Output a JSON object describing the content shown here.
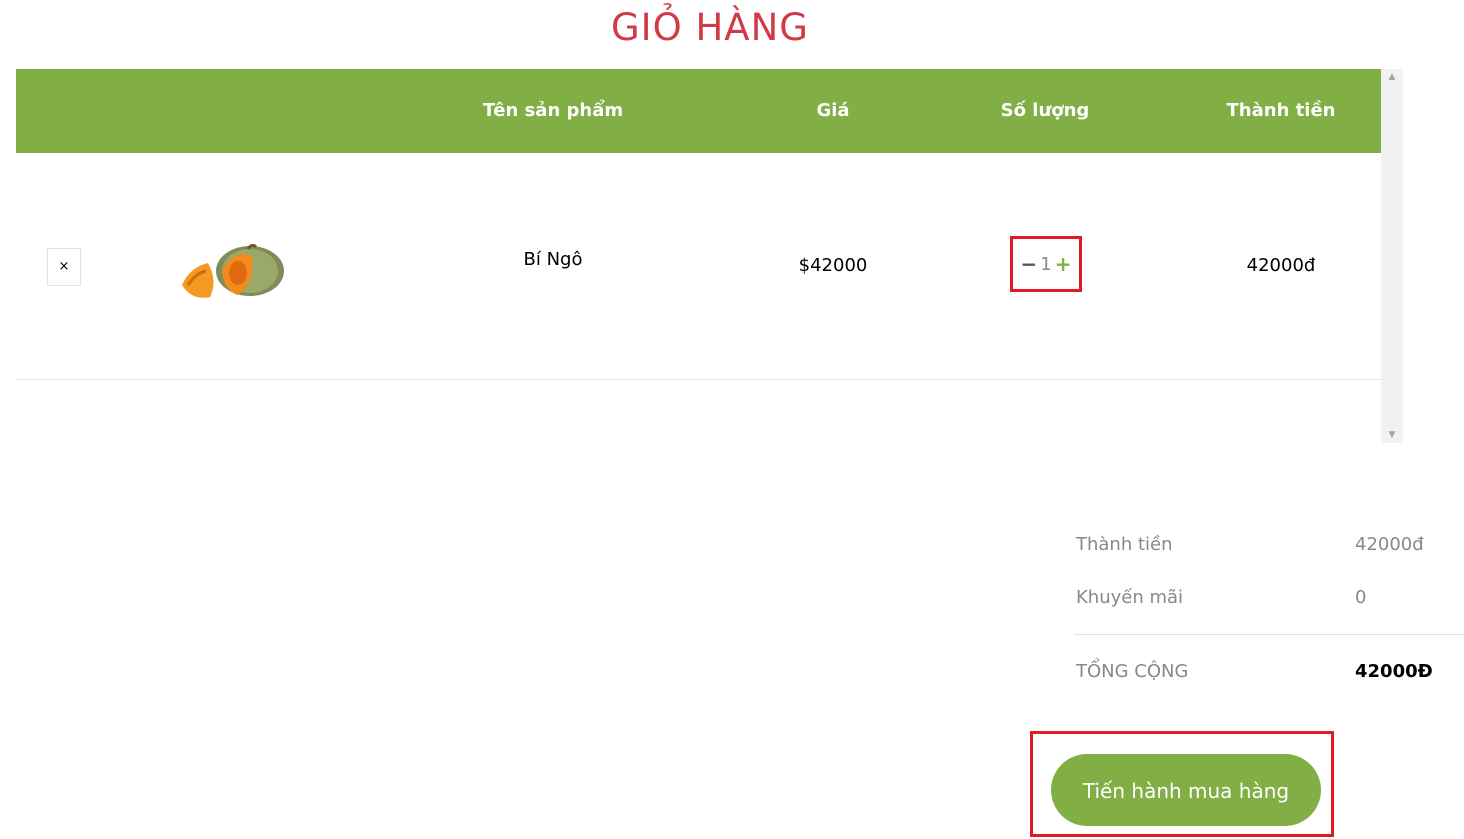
{
  "page": {
    "title": "GIỎ HÀNG"
  },
  "table": {
    "headers": [
      "",
      "",
      "Tên sản phẩm",
      "Giá",
      "Số lượng",
      "Thành tiền"
    ],
    "rows": [
      {
        "remove_icon": "×",
        "image": "pumpkin-image",
        "name": "Bí Ngô",
        "price": "$42000",
        "quantity": "1",
        "total": "42000đ"
      }
    ]
  },
  "quantity_controls": {
    "minus": "−",
    "plus": "+"
  },
  "scrollbar": {
    "up": "▲",
    "down": "▼"
  },
  "summary": {
    "subtotal_label": "Thành tiền",
    "subtotal_value": "42000đ",
    "discount_label": "Khuyến mãi",
    "discount_value": "0",
    "total_label": "TỔNG CỘNG",
    "total_value": "42000Đ"
  },
  "checkout": {
    "label": "Tiến hành mua hàng"
  },
  "colors": {
    "brand_green": "#82ae46",
    "title_red": "#d13a47",
    "highlight_red": "#e01b24"
  }
}
